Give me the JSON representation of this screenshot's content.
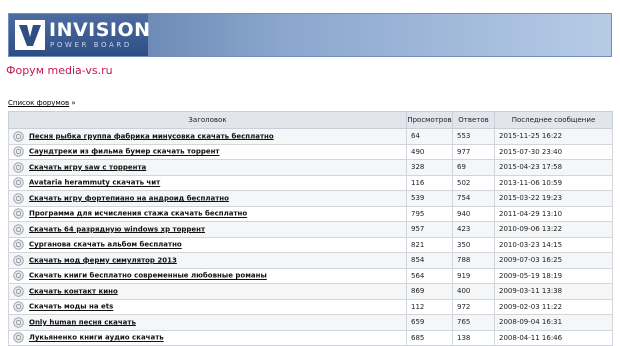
{
  "header": {
    "logo_word": "INVISION",
    "logo_sub": "POWER BOARD"
  },
  "forum_title": "Форум media-vs.ru",
  "breadcrumb": {
    "root_label": "Список форумов",
    "separator": "»"
  },
  "table": {
    "columns": [
      "Заголовок",
      "Просмотров",
      "Ответов",
      "Последнее сообщение"
    ],
    "rows": [
      {
        "title": "Песня рыбка группа фабрика минусовка скачать бесплатно",
        "views": "64",
        "replies": "553",
        "last": "2015-11-25 16:22"
      },
      {
        "title": "Саундтреки из фильма бумер скачать торрент",
        "views": "490",
        "replies": "977",
        "last": "2015-07-30 23:40"
      },
      {
        "title": "Скачать игру saw с торрента",
        "views": "328",
        "replies": "69",
        "last": "2015-04-23 17:58"
      },
      {
        "title": "Avataria herammuty скачать чит",
        "views": "116",
        "replies": "502",
        "last": "2013-11-06 10:59"
      },
      {
        "title": "Скачать игру фортепиано на андроид бесплатно",
        "views": "539",
        "replies": "754",
        "last": "2015-03-22 19:23"
      },
      {
        "title": "Программа для исчисления стажа скачать бесплатно",
        "views": "795",
        "replies": "940",
        "last": "2011-04-29 13:10"
      },
      {
        "title": "Скачать 64 разрядную windows xp торрент",
        "views": "957",
        "replies": "423",
        "last": "2010-09-06 13:22"
      },
      {
        "title": "Сурганова скачать альбом бесплатно",
        "views": "821",
        "replies": "350",
        "last": "2010-03-23 14:15"
      },
      {
        "title": "Скачать мод ферму симулятор 2013",
        "views": "854",
        "replies": "788",
        "last": "2009-07-03 16:25"
      },
      {
        "title": "Скачать книги бесплатно современные любовные романы",
        "views": "564",
        "replies": "919",
        "last": "2009-05-19 18:19"
      },
      {
        "title": "Скачать контакт кино",
        "views": "869",
        "replies": "400",
        "last": "2009-03-11 13:38"
      },
      {
        "title": "Скачать моды на ets",
        "views": "112",
        "replies": "972",
        "last": "2009-02-03 11:22"
      },
      {
        "title": "Only human песня скачать",
        "views": "659",
        "replies": "765",
        "last": "2008-09-04 16:31"
      },
      {
        "title": "Лукьяненко книги аудио скачать",
        "views": "685",
        "replies": "138",
        "last": "2008-04-11 16:46"
      }
    ]
  }
}
